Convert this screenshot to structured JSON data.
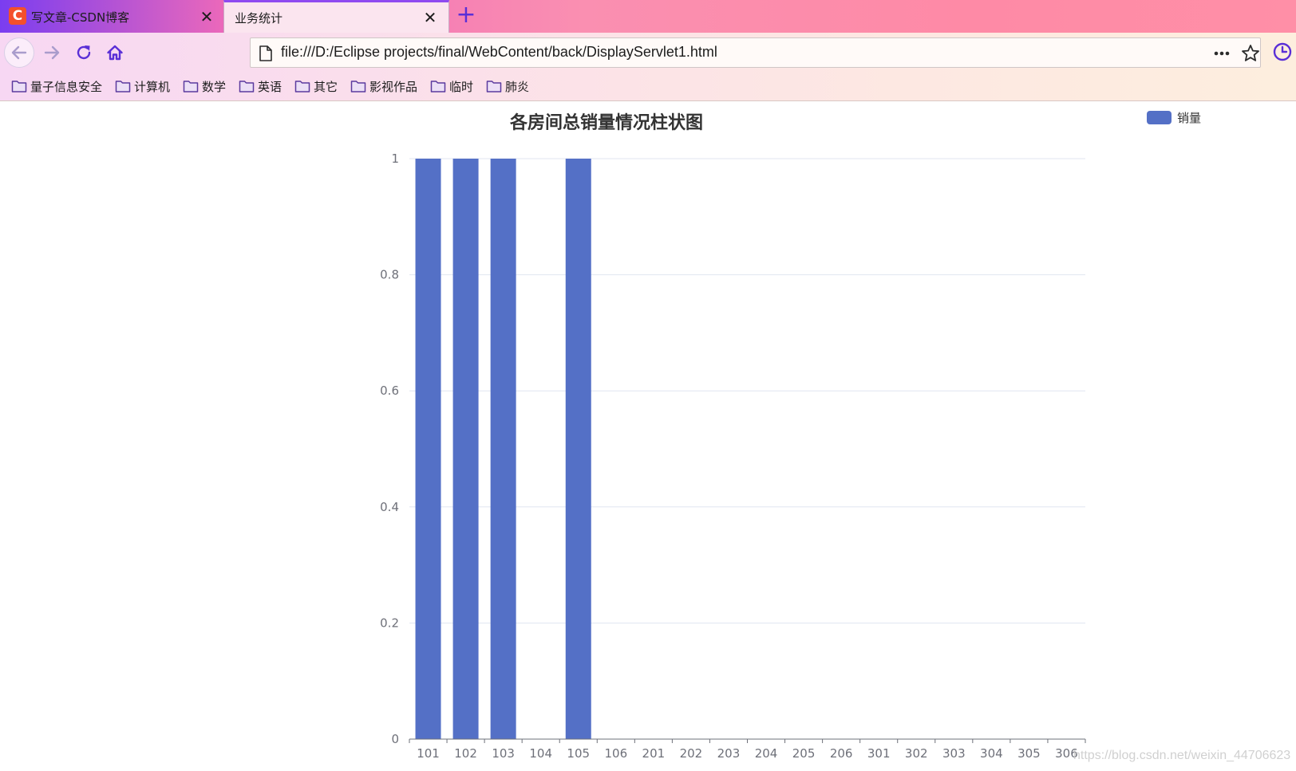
{
  "browser": {
    "tabs": [
      {
        "title": "写文章-CSDN博客",
        "active": false,
        "favicon": "C"
      },
      {
        "title": "业务统计",
        "active": true
      }
    ],
    "new_tab_icon": "plus-icon",
    "url": "file:///D:/Eclipse projects/final/WebContent/back/DisplayServlet1.html",
    "bookmarks": [
      "量子信息安全",
      "计算机",
      "数学",
      "英语",
      "其它",
      "影视作品",
      "临时",
      "肺炎"
    ],
    "colors": {
      "accent": "#5a2fd6",
      "tab_active_border": "#8f4af0"
    }
  },
  "chart_data": {
    "type": "bar",
    "title": "各房间总销量情况柱状图",
    "legend": {
      "position": "top-right"
    },
    "categories": [
      "101",
      "102",
      "103",
      "104",
      "105",
      "106",
      "201",
      "202",
      "203",
      "204",
      "205",
      "206",
      "301",
      "302",
      "303",
      "304",
      "305",
      "306"
    ],
    "series": [
      {
        "name": "销量",
        "color": "#5470c6",
        "values": [
          1,
          1,
          1,
          0,
          1,
          0,
          0,
          0,
          0,
          0,
          0,
          0,
          0,
          0,
          0,
          0,
          0,
          0
        ]
      }
    ],
    "ylim": [
      0,
      1
    ],
    "yticks": [
      "0",
      "0.2",
      "0.4",
      "0.6",
      "0.8",
      "1"
    ],
    "grid": true
  },
  "watermark": "https://blog.csdn.net/weixin_44706623"
}
